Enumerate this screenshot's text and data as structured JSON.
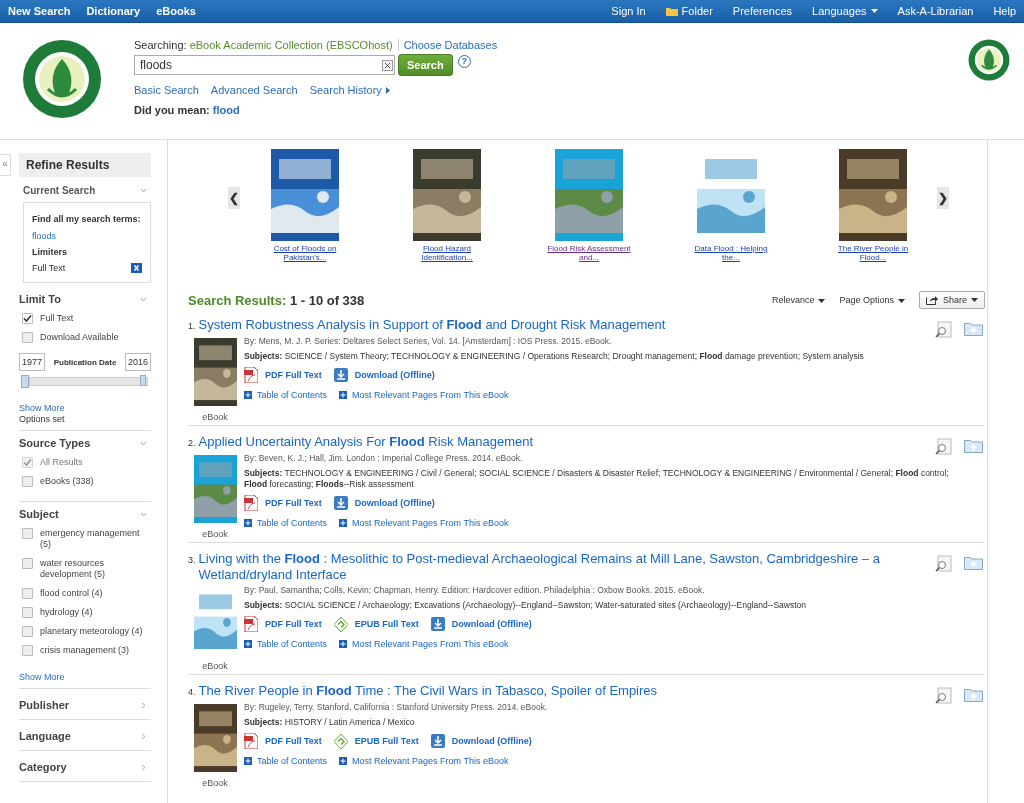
{
  "top_nav": {
    "left": [
      {
        "label": "New Search"
      },
      {
        "label": "Dictionary"
      },
      {
        "label": "eBooks"
      }
    ],
    "right": [
      {
        "label": "Sign In",
        "kind": "link"
      },
      {
        "label": "Folder",
        "kind": "folder"
      },
      {
        "label": "Preferences",
        "kind": "link"
      },
      {
        "label": "Languages",
        "kind": "dropdown"
      },
      {
        "label": "Ask-A-Librarian",
        "kind": "link"
      },
      {
        "label": "Help",
        "kind": "link"
      }
    ]
  },
  "search": {
    "searching_label": "Searching:",
    "database": "eBook Academic Collection (EBSCOhost)",
    "choose": "Choose Databases",
    "value": "floods",
    "button": "Search",
    "help": "?",
    "links": [
      "Basic Search",
      "Advanced Search",
      "Search History"
    ],
    "did_you_mean_label": "Did you mean:",
    "suggestion": "flood"
  },
  "sidebar": {
    "collapse": "«",
    "title": "Refine Results",
    "sections": [
      {
        "kind": "current",
        "heading": "Current Search",
        "box_heading": "Find all my search terms:",
        "term": "floods",
        "limiters_heading": "Limiters",
        "limiter": "Full Text"
      },
      {
        "kind": "limit",
        "heading": "Limit To",
        "options": [
          {
            "label": "Full Text",
            "checked": true
          },
          {
            "label": "Download Available",
            "checked": false
          }
        ],
        "date_from": "1977",
        "date_label": "Publication Date",
        "date_to": "2016",
        "level": 1,
        "show_more": "Show More",
        "note": "Options set"
      },
      {
        "kind": "checklist",
        "heading": "Source Types",
        "options": [
          {
            "label": "All Results",
            "checked": true,
            "disabled": true
          },
          {
            "label": "eBooks (338)",
            "checked": false,
            "disabled": false
          }
        ]
      },
      {
        "kind": "checklist",
        "heading": "Subject",
        "options": [
          {
            "label": "emergency management (5)",
            "checked": false,
            "disabled": false
          },
          {
            "label": "water resources development (5)",
            "checked": false,
            "disabled": false
          },
          {
            "label": "flood control (4)",
            "checked": false,
            "disabled": false
          },
          {
            "label": "hydrology (4)",
            "checked": false,
            "disabled": false
          },
          {
            "label": "planetary meteorology (4)",
            "checked": false,
            "disabled": false
          },
          {
            "label": "crisis management (3)",
            "checked": false,
            "disabled": false
          }
        ],
        "show_more": "Show More"
      },
      {
        "kind": "collapsed",
        "heading": "Publisher"
      },
      {
        "kind": "collapsed",
        "heading": "Language"
      },
      {
        "kind": "collapsed",
        "heading": "Category"
      }
    ]
  },
  "carousel": {
    "prev": "❮",
    "next": "❯",
    "items": [
      {
        "title": "Cost of Floods on Pakistan's...",
        "visited": false
      },
      {
        "title": "Flood Hazard Identification...",
        "visited": false
      },
      {
        "title": "Flood Risk Assessment and...",
        "visited": true
      },
      {
        "title": "Data Flood : Helping the...",
        "visited": false
      },
      {
        "title": "The River People in Flood...",
        "visited": false
      }
    ]
  },
  "results_header": {
    "label": "Search Results:",
    "range": "1 - 10 of 338",
    "sort": "Relevance",
    "page_options": "Page Options",
    "share": "Share"
  },
  "results": [
    {
      "number": "1.",
      "title": "System Robustness Analysis in Support of **Flood** and Drought Risk Management",
      "byline": "By: Mens, M. J. P. Series: Deltares Select Series, Vol. 14. [Amsterdam] : IOS Press. 2015. eBook.",
      "subjects": "**Subjects:** SCIENCE / System Theory; TECHNOLOGY & ENGINEERING / Operations Research; Drought management; **Flood** damage prevention; System analysis",
      "links": [
        {
          "kind": "pdf",
          "label": "PDF Full Text"
        },
        {
          "kind": "download",
          "label": "Download (Offline)"
        }
      ],
      "extras": [
        "Table of Contents",
        "Most Relevant Pages From This eBook"
      ],
      "type": "eBook"
    },
    {
      "number": "2.",
      "title": "Applied Uncertainty Analysis For **Flood** Risk Management",
      "byline": "By: Beven, K. J.; Hall, Jim. London : Imperial College Press. 2014. eBook.",
      "subjects": "**Subjects:** TECHNOLOGY & ENGINEERING / Civil / General; SOCIAL SCIENCE / Disasters & Disaster Relief; TECHNOLOGY & ENGINEERING / Environmental / General; **Flood** control; **Flood** forecasting; **Floods**--Risk assessment",
      "links": [
        {
          "kind": "pdf",
          "label": "PDF Full Text"
        },
        {
          "kind": "download",
          "label": "Download (Offline)"
        }
      ],
      "extras": [
        "Table of Contents",
        "Most Relevant Pages From This eBook"
      ],
      "type": "eBook"
    },
    {
      "number": "3.",
      "title": "Living with the **Flood** : Mesolithic to Post-medieval Archaeological Remains at Mill Lane, Sawston, Cambridgeshire – a Wetland/dryland Interface",
      "byline": "By: Paul, Samantha; Colls, Kevin; Chapman, Henry. Edition: Hardcover edition. Philadelphia : Oxbow Books. 2015. eBook.",
      "subjects": "**Subjects:** SOCIAL SCIENCE / Archaeology; Excavations (Archaeology)--England--Sawston; Water-saturated sites (Archaeology)--England--Sawston",
      "links": [
        {
          "kind": "pdf",
          "label": "PDF Full Text"
        },
        {
          "kind": "epub",
          "label": "EPUB Full Text"
        },
        {
          "kind": "download",
          "label": "Download (Offline)"
        }
      ],
      "extras": [
        "Table of Contents",
        "Most Relevant Pages From This eBook"
      ],
      "type": "eBook"
    },
    {
      "number": "4.",
      "title": "The River People in **Flood** Time : The Civil Wars in Tabasco, Spoiler of Empires",
      "byline": "By: Rugeley, Terry. Stanford, California : Stanford University Press. 2014. eBook.",
      "subjects": "**Subjects:** HISTORY / Latin America / Mexico",
      "links": [
        {
          "kind": "pdf",
          "label": "PDF Full Text"
        },
        {
          "kind": "epub",
          "label": "EPUB Full Text"
        },
        {
          "kind": "download",
          "label": "Download (Offline)"
        }
      ],
      "extras": [
        "Table of Contents",
        "Most Relevant Pages From This eBook"
      ],
      "type": "eBook"
    }
  ]
}
